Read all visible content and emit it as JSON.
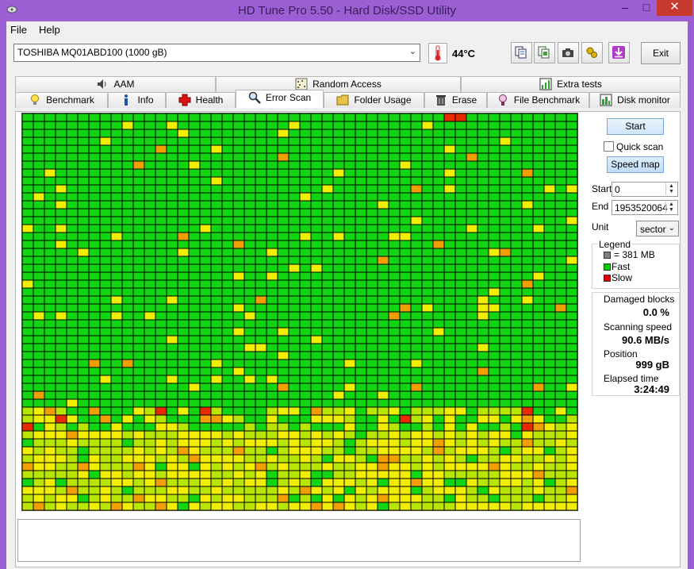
{
  "window": {
    "title": "HD Tune Pro 5.50 - Hard Disk/SSD Utility",
    "minimize_glyph": "–",
    "maximize_glyph": "□",
    "close_glyph": "✕"
  },
  "menu": {
    "file_label": "File",
    "help_label": "Help"
  },
  "toolbar": {
    "drive_selected": "TOSHIBA MQ01ABD100 (1000 gB)",
    "temperature": "44°C",
    "exit_label": "Exit",
    "icons": [
      "copy-text-icon",
      "copy-info-icon",
      "screenshot-camera-icon",
      "options-icon",
      "save-download-icon"
    ]
  },
  "tabs": {
    "row1": [
      {
        "label": "AAM",
        "icon": "speaker-icon"
      },
      {
        "label": "Random Access",
        "icon": "random-access-icon"
      },
      {
        "label": "Extra tests",
        "icon": "extra-tests-icon"
      }
    ],
    "row2": [
      {
        "label": "Benchmark",
        "icon": "benchmark-icon"
      },
      {
        "label": "Info",
        "icon": "info-icon"
      },
      {
        "label": "Health",
        "icon": "health-cross-icon"
      },
      {
        "label": "Error Scan",
        "icon": "magnifier-icon",
        "active": true
      },
      {
        "label": "Folder Usage",
        "icon": "folder-icon"
      },
      {
        "label": "Erase",
        "icon": "trash-icon"
      },
      {
        "label": "File Benchmark",
        "icon": "file-benchmark-icon"
      },
      {
        "label": "Disk monitor",
        "icon": "disk-monitor-icon"
      }
    ]
  },
  "controls": {
    "start_label": "Start",
    "quick_scan_label": "Quick scan",
    "quick_scan_checked": false,
    "speed_map_label": "Speed map",
    "start_field_label": "Start",
    "start_value": "0",
    "end_field_label": "End",
    "end_value": "1953520064",
    "unit_label": "Unit",
    "unit_value": "sector"
  },
  "legend": {
    "title": "Legend",
    "items": [
      {
        "label": "= 381 MB",
        "color": "#808080"
      },
      {
        "label": "Fast",
        "color": "#00CC00"
      },
      {
        "label": "Slow",
        "color": "#E00000"
      }
    ]
  },
  "stats": {
    "damaged_label": "Damaged blocks",
    "damaged_value": "0.0 %",
    "speed_label": "Scanning speed",
    "speed_value": "90.6 MB/s",
    "position_label": "Position",
    "position_value": "999 gB",
    "elapsed_label": "Elapsed time",
    "elapsed_value": "3:24:49"
  },
  "scan_map": {
    "columns": 50,
    "rows": 50,
    "palette": {
      "fast": "#11D611",
      "yellow_green": "#B8E600",
      "yellow": "#F2EE00",
      "orange": "#F2A000",
      "slow": "#E82A00"
    },
    "blocks_described": "speed map grid of block status cells"
  }
}
